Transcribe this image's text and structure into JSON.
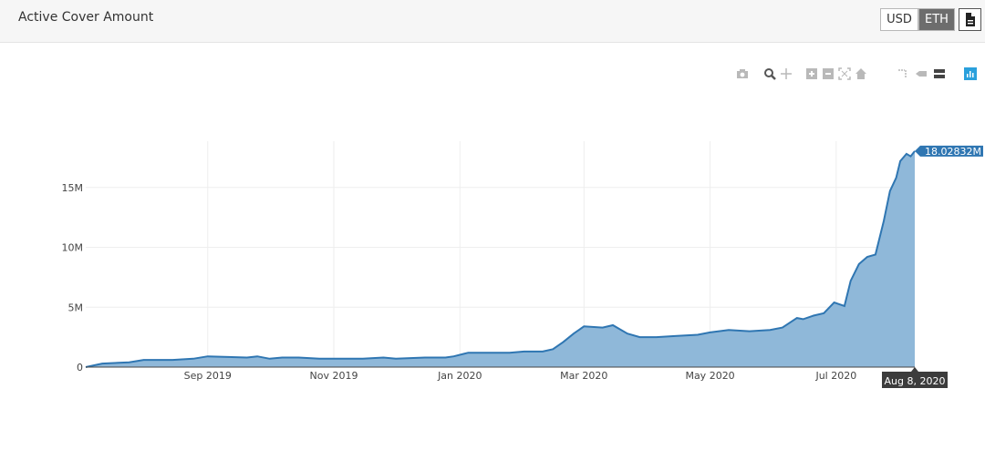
{
  "header": {
    "title": "Active Cover Amount",
    "usd_label": "USD",
    "eth_label": "ETH",
    "export_icon": "document-icon"
  },
  "modebar": [
    "camera-icon",
    "zoom-icon",
    "pan-icon",
    "zoom-in-icon",
    "zoom-out-icon",
    "autoscale-icon",
    "home-icon",
    "spike-lines-icon",
    "hover-closest-icon",
    "hover-compare-icon",
    "plotly-logo-icon"
  ],
  "colors": {
    "line": "#2f76b2",
    "fill": "#8fb8d9",
    "grid": "#eeeeee",
    "header_bg": "#f6f6f6",
    "eth_active": "#6d6d6d",
    "logo": "#2aa0dc"
  },
  "chart_data": {
    "type": "area",
    "title": "",
    "xlabel": "",
    "ylabel": "",
    "x_ticks": [
      "Sep 2019",
      "Nov 2019",
      "Jan 2020",
      "Mar 2020",
      "May 2020",
      "Jul 2020"
    ],
    "y_ticks": [
      "0",
      "5M",
      "10M",
      "15M"
    ],
    "ylim": [
      0,
      20000000
    ],
    "grid": true,
    "legend": "none",
    "hover_value": "18.02832M",
    "hover_date": "Aug 8, 2020",
    "x": [
      "2019-07-04",
      "2019-07-12",
      "2019-07-25",
      "2019-08-01",
      "2019-08-15",
      "2019-08-25",
      "2019-09-01",
      "2019-09-20",
      "2019-09-25",
      "2019-10-01",
      "2019-10-07",
      "2019-10-15",
      "2019-10-25",
      "2019-11-01",
      "2019-11-15",
      "2019-11-25",
      "2019-12-01",
      "2019-12-15",
      "2019-12-25",
      "2019-12-29",
      "2020-01-05",
      "2020-01-15",
      "2020-01-25",
      "2020-02-01",
      "2020-02-10",
      "2020-02-15",
      "2020-02-20",
      "2020-02-25",
      "2020-03-01",
      "2020-03-10",
      "2020-03-15",
      "2020-03-22",
      "2020-03-28",
      "2020-04-05",
      "2020-04-15",
      "2020-04-25",
      "2020-05-01",
      "2020-05-10",
      "2020-05-20",
      "2020-05-30",
      "2020-06-05",
      "2020-06-12",
      "2020-06-15",
      "2020-06-20",
      "2020-06-25",
      "2020-06-30",
      "2020-07-05",
      "2020-07-08",
      "2020-07-12",
      "2020-07-16",
      "2020-07-20",
      "2020-07-24",
      "2020-07-27",
      "2020-07-30",
      "2020-08-01",
      "2020-08-04",
      "2020-08-06",
      "2020-08-08"
    ],
    "y": [
      0,
      300000,
      400000,
      600000,
      600000,
      700000,
      900000,
      800000,
      900000,
      700000,
      800000,
      800000,
      700000,
      700000,
      700000,
      800000,
      700000,
      800000,
      800000,
      900000,
      1200000,
      1200000,
      1200000,
      1300000,
      1300000,
      1500000,
      2100000,
      2800000,
      3400000,
      3300000,
      3500000,
      2800000,
      2500000,
      2500000,
      2600000,
      2700000,
      2900000,
      3100000,
      3000000,
      3100000,
      3300000,
      4100000,
      4000000,
      4300000,
      4500000,
      5400000,
      5100000,
      7200000,
      8600000,
      9200000,
      9400000,
      12200000,
      14700000,
      15800000,
      17200000,
      17800000,
      17600000,
      18028320
    ]
  }
}
